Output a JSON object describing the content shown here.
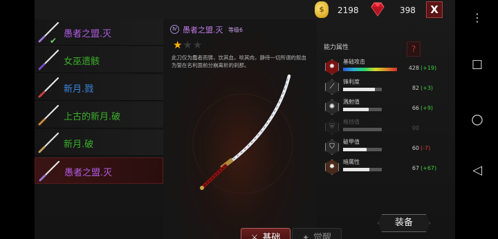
{
  "currency": {
    "coin_icon": "gold-coin-icon",
    "coins": "2198",
    "gem_icon": "ruby-gem-icon",
    "gems": "398",
    "close_label": "X"
  },
  "weapons": [
    {
      "name": "愚者之盟.灭",
      "color": "#b35de8",
      "equipped": true,
      "check": "✔"
    },
    {
      "name": "女巫遗骸",
      "color": "#3bb02a"
    },
    {
      "name": "新月.戮",
      "color": "#3a88e0"
    },
    {
      "name": "上古的新月.破",
      "color": "#3bb02a"
    },
    {
      "name": "新月.破",
      "color": "#3bb02a"
    },
    {
      "name": "愚者之盟.灭",
      "color": "#b35de8",
      "selected": true
    }
  ],
  "detail": {
    "tier_badge": "Ⅳ",
    "title": "愚者之盟.灭",
    "level": "等级6",
    "stars": {
      "filled": 1,
      "total": 3
    },
    "description": "此刀仅为蠢者而铸，饮其血，啖其肉，静待一切所谓的叙血为誓在名利面前分崩离析的刹那。"
  },
  "tabs": {
    "base": "基础",
    "awaken": "觉醒"
  },
  "stats": {
    "title": "能力属性",
    "help": "?",
    "rows": [
      {
        "name": "基础攻击",
        "value": "428",
        "delta": "(+19)",
        "delta_color": "#3fcf3f",
        "fill": 1.0,
        "rainbow": true,
        "icon": "attack-icon"
      },
      {
        "name": "锋利度",
        "value": "82",
        "delta": "(+3)",
        "delta_color": "#3fcf3f",
        "fill": 0.82,
        "icon": "sharpness-icon"
      },
      {
        "name": "溅射值",
        "value": "66",
        "delta": "(+9)",
        "delta_color": "#3fcf3f",
        "fill": 0.66,
        "icon": "splash-icon"
      },
      {
        "name": "格挡值",
        "value": "00",
        "delta": "",
        "delta_color": "#555555",
        "fill": 0.0,
        "dim": true,
        "icon": "block-icon"
      },
      {
        "name": "破甲值",
        "value": "60",
        "delta": "(-7)",
        "delta_color": "#e03a3a",
        "fill": 0.6,
        "icon": "armor-break-icon"
      },
      {
        "name": "暗属性",
        "value": "67",
        "delta": "(+67)",
        "delta_color": "#3fcf3f",
        "fill": 0.67,
        "icon": "dark-attribute-icon"
      }
    ]
  },
  "equip_label": "装备",
  "android": {
    "menu": "⋮",
    "recent": "☐",
    "home": "○",
    "back": "◁"
  }
}
